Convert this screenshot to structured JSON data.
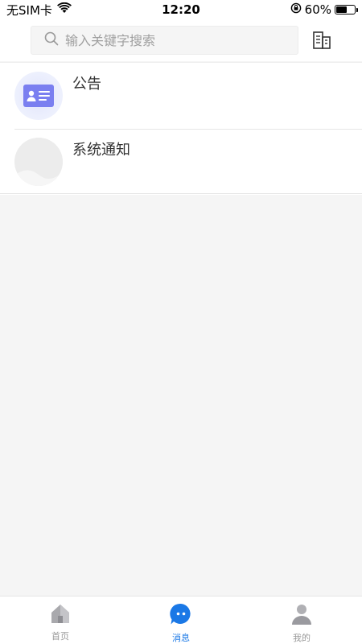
{
  "status_bar": {
    "carrier": "无SIM卡",
    "time": "12:20",
    "battery_percent": "60%",
    "battery_level": 0.6,
    "icons": [
      "wifi-icon",
      "orientation-lock-icon",
      "battery-icon"
    ]
  },
  "search": {
    "placeholder": "输入关键字搜索",
    "icon": "search-icon"
  },
  "header": {
    "org_icon": "building-icon"
  },
  "messages": [
    {
      "title": "公告",
      "icon": "notice-card-icon"
    },
    {
      "title": "系统通知",
      "icon": "system-avatar-icon"
    }
  ],
  "tabs": [
    {
      "label": "首页",
      "icon": "home-icon",
      "active": false
    },
    {
      "label": "消息",
      "icon": "chat-bubble-icon",
      "active": true
    },
    {
      "label": "我的",
      "icon": "user-icon",
      "active": false
    }
  ],
  "colors": {
    "accent": "#1a78e6",
    "background": "#f5f5f5",
    "notice_card": "#7a7ff0"
  }
}
